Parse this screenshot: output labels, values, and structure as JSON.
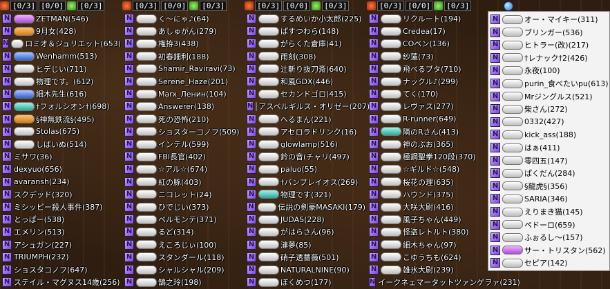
{
  "header": {
    "red_count": "[0/3]",
    "mid_count": "[0/0]",
    "green_count": "[0/3]"
  },
  "columns": [
    {
      "rows": [
        {
          "name": "ZETMAN(546)",
          "badge": "purple"
        },
        {
          "name": "9月女(428)",
          "badge": "orange"
        },
        {
          "name": "ロミオ＆ジュリエット(653)",
          "badge": "white"
        },
        {
          "name": "Wenhamm(513)",
          "badge": "blue"
        },
        {
          "name": "ヒデじい(711)",
          "badge": "white"
        },
        {
          "name": "物理です。(612)",
          "badge": "white"
        },
        {
          "name": "細木先生(616)",
          "badge": "blue"
        },
        {
          "name": "†フォルシオン†(698)",
          "badge": "teal"
        },
        {
          "name": "§神無鉄流§(495)",
          "badge": "orange"
        },
        {
          "name": "Stolas(675)",
          "badge": "white"
        },
        {
          "name": "しばいぬ(514)",
          "badge": "white"
        },
        {
          "name": "ミサワ(36)",
          "badge": "none"
        },
        {
          "name": "dexyuo(656)",
          "badge": "none"
        },
        {
          "name": "avaransh(234)",
          "badge": "none"
        },
        {
          "name": "スクデッド(320)",
          "badge": "none"
        },
        {
          "name": "ミシッピー殺人事件(387)",
          "badge": "none"
        },
        {
          "name": "とっぱー(538)",
          "badge": "none"
        },
        {
          "name": "エメリン(513)",
          "badge": "none"
        },
        {
          "name": "アシュガン(227)",
          "badge": "none"
        },
        {
          "name": "TRIUMPH(232)",
          "badge": "none"
        },
        {
          "name": "ショスタコノフ(647)",
          "badge": "none"
        },
        {
          "name": "ステイル・マグヌス14歳(256)",
          "badge": "none"
        }
      ]
    },
    {
      "rows": [
        {
          "name": "く～にゃ♪(64)",
          "badge": "white"
        },
        {
          "name": "あしゅがん(279)",
          "badge": "white"
        },
        {
          "name": "権拵3(438)",
          "badge": "white"
        },
        {
          "name": "初春鈿利(188)",
          "badge": "white"
        },
        {
          "name": "Shamir_Raviravi(73)",
          "badge": "white"
        },
        {
          "name": "Serene_Haze(201)",
          "badge": "white"
        },
        {
          "name": "Marx_Ленин(104)",
          "badge": "white"
        },
        {
          "name": "Answerer(138)",
          "badge": "white"
        },
        {
          "name": "死の恐怖(210)",
          "badge": "white"
        },
        {
          "name": "ショスターコノフ(509)",
          "badge": "white"
        },
        {
          "name": "インテル(599)",
          "badge": "white"
        },
        {
          "name": "FBI長官(402)",
          "badge": "white"
        },
        {
          "name": "☆アル☆(674)",
          "badge": "white"
        },
        {
          "name": "紅の豚(403)",
          "badge": "white"
        },
        {
          "name": "ニコレット(24)",
          "badge": "white"
        },
        {
          "name": "ひでじい(373)",
          "badge": "white"
        },
        {
          "name": "ベルモンテ(371)",
          "badge": "white"
        },
        {
          "name": "るど(314)",
          "badge": "white"
        },
        {
          "name": "えころじぃ(100)",
          "badge": "white"
        },
        {
          "name": "スタンダール(118)",
          "badge": "white"
        },
        {
          "name": "シャルシャル(209)",
          "badge": "white"
        },
        {
          "name": "鵠之玲(198)",
          "badge": "white"
        }
      ]
    },
    {
      "rows": [
        {
          "name": "するめいか小太郎(225)",
          "badge": "white"
        },
        {
          "name": "ぱすつわら(148)",
          "badge": "white"
        },
        {
          "name": "がらくた倉庫(41)",
          "badge": "white"
        },
        {
          "name": "雨刻(308)",
          "badge": "white"
        },
        {
          "name": "辻斬り抜刀斎(640)",
          "badge": "white"
        },
        {
          "name": "和風GDX(446)",
          "badge": "white"
        },
        {
          "name": "セカンドゴロ(415)",
          "badge": "white"
        },
        {
          "name": "アスベルギルス・オリゼー(207)",
          "badge": "white"
        },
        {
          "name": "へるまん(221)",
          "badge": "white"
        },
        {
          "name": "アセロラドリンク(16)",
          "badge": "white"
        },
        {
          "name": "glowlamp(516)",
          "badge": "white"
        },
        {
          "name": "鈴の音(チャリ(497)",
          "badge": "white"
        },
        {
          "name": "paluo(55)",
          "badge": "white"
        },
        {
          "name": "†バンプレイオス(269)",
          "badge": "white"
        },
        {
          "name": "物理です(321)",
          "badge": "teal"
        },
        {
          "name": "伝説の剣豪MASAKI(179)",
          "badge": "white"
        },
        {
          "name": "JUDAS(228)",
          "badge": "white"
        },
        {
          "name": "がはらさん(96)",
          "badge": "white"
        },
        {
          "name": "漣夢(85)",
          "badge": "white"
        },
        {
          "name": "硝子透薔薇(501)",
          "badge": "white"
        },
        {
          "name": "NATURALNINE(90)",
          "badge": "white"
        },
        {
          "name": "ぼくめつ(177)",
          "badge": "white"
        }
      ]
    },
    {
      "rows": [
        {
          "name": "リクルート(194)",
          "badge": "white"
        },
        {
          "name": "Credea(17)",
          "badge": "white"
        },
        {
          "name": "COベン(136)",
          "badge": "white"
        },
        {
          "name": "紗蓮(73)",
          "badge": "white"
        },
        {
          "name": "飛べるブタ(710)",
          "badge": "white"
        },
        {
          "name": "ナックル♪(299)",
          "badge": "white"
        },
        {
          "name": "てく(170)",
          "badge": "white"
        },
        {
          "name": "レヴァス(277)",
          "badge": "white"
        },
        {
          "name": "R-runner(649)",
          "badge": "white"
        },
        {
          "name": "隣のRさん(413)",
          "badge": "teal"
        },
        {
          "name": "神のぶお(365)",
          "badge": "white"
        },
        {
          "name": "極鋼聖拳120段(370)",
          "badge": "white"
        },
        {
          "name": "☆ギルド☆(548)",
          "badge": "white"
        },
        {
          "name": "桜花の理(635)",
          "badge": "white"
        },
        {
          "name": "ハウンド(375)",
          "badge": "white"
        },
        {
          "name": "大咲大尉(416)",
          "badge": "white"
        },
        {
          "name": "風子ちゃん(449)",
          "badge": "white"
        },
        {
          "name": "怪盗レトルト(380)",
          "badge": "white"
        },
        {
          "name": "細木ちゃん(97)",
          "badge": "white"
        },
        {
          "name": "こゆうちも(624)",
          "badge": "white"
        },
        {
          "name": "雄氷大尉(239)",
          "badge": "white"
        },
        {
          "name": "イークネェマータットツァンゲヲァ(231)",
          "badge": "none"
        }
      ]
    }
  ],
  "panel": {
    "rows": [
      {
        "name": "オー・マイキー(311)",
        "badge": "white"
      },
      {
        "name": "ブリンガー(536)",
        "badge": "white"
      },
      {
        "name": "ヒトラー(改)(217)",
        "badge": "white"
      },
      {
        "name": "†レナック†2(426)",
        "badge": "white"
      },
      {
        "name": "永夜(100)",
        "badge": "white"
      },
      {
        "name": "purin_食べたいpu(613)",
        "badge": "white"
      },
      {
        "name": "Mrジングルス(521)",
        "badge": "white"
      },
      {
        "name": "柴さん(272)",
        "badge": "white"
      },
      {
        "name": "0332(427)",
        "badge": "white"
      },
      {
        "name": "kick_ass(188)",
        "badge": "white"
      },
      {
        "name": "はぁ(411)",
        "badge": "white"
      },
      {
        "name": "零四五(147)",
        "badge": "white"
      },
      {
        "name": "ぱくだん(284)",
        "badge": "white"
      },
      {
        "name": "§龍虎§(356)",
        "badge": "white"
      },
      {
        "name": "SARIA(346)",
        "badge": "white"
      },
      {
        "name": "えりまき猫(145)",
        "badge": "white"
      },
      {
        "name": "ペドーロ(659)",
        "badge": "white"
      },
      {
        "name": "ふぉるし～(157)",
        "badge": "white"
      },
      {
        "name": "サー・トリスタン(562)",
        "badge": "purple"
      },
      {
        "name": "セピア(142)",
        "badge": "white"
      }
    ]
  }
}
